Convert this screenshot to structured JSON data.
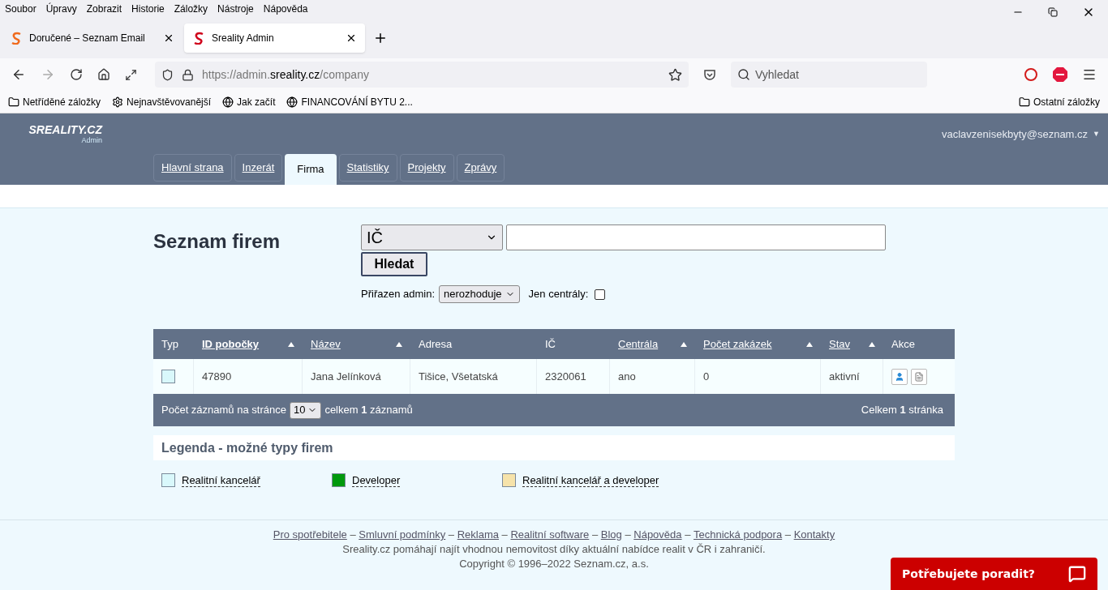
{
  "menubar": [
    "Soubor",
    "Úpravy",
    "Zobrazit",
    "Historie",
    "Záložky",
    "Nástroje",
    "Nápověda"
  ],
  "browser_tabs": [
    {
      "title": "Doručené – Seznam Email",
      "selected": false
    },
    {
      "title": "Sreality Admin",
      "selected": true
    }
  ],
  "address_bar": {
    "prefix": "https://admin.",
    "domain": "sreality.cz",
    "path": "/company"
  },
  "search_bar": {
    "placeholder": "Vyhledat"
  },
  "bookmarks": [
    "Netříděné záložky",
    "Nejnavštěvovanější",
    "Jak začít",
    "FINANCOVÁNÍ BYTU 2..."
  ],
  "other_bookmarks": "Ostatní záložky",
  "site_header": {
    "logo": "SREALITY.CZ",
    "logo_sub": "Admin",
    "user": "vaclavzenisekbyty@seznam.cz",
    "user_caret": "▼"
  },
  "nav_tabs": [
    {
      "label": "Hlavní strana",
      "selected": false
    },
    {
      "label": "Inzerát",
      "selected": false
    },
    {
      "label": "Firma",
      "selected": true
    },
    {
      "label": "Statistiky",
      "selected": false
    },
    {
      "label": "Projekty",
      "selected": false
    },
    {
      "label": "Zprávy",
      "selected": false
    }
  ],
  "search_form": {
    "title": "Seznam firem",
    "field_select": "IČ",
    "button": "Hledat",
    "admin_label": "Přiřazen admin:",
    "admin_select": "nerozhoduje",
    "central_label": "Jen centrály:",
    "central_checked": false
  },
  "table": {
    "columns": [
      {
        "label": "Typ",
        "kind": "type",
        "sortable": false,
        "bold": false
      },
      {
        "label": "ID pobočky",
        "kind": "text",
        "sortable": true,
        "bold": true
      },
      {
        "label": "Název",
        "kind": "text",
        "sortable": true,
        "bold": false
      },
      {
        "label": "Adresa",
        "kind": "text",
        "sortable": false,
        "bold": false
      },
      {
        "label": "IČ",
        "kind": "text",
        "sortable": false,
        "bold": false
      },
      {
        "label": "Centrála",
        "kind": "text",
        "sortable": true,
        "bold": false
      },
      {
        "label": "Počet zakázek",
        "kind": "text",
        "sortable": true,
        "bold": false
      },
      {
        "label": "Stav",
        "kind": "text",
        "sortable": true,
        "bold": false
      },
      {
        "label": "Akce",
        "kind": "actions",
        "sortable": false,
        "bold": false
      }
    ],
    "rows": [
      {
        "color": "#d9f8fb",
        "cells": [
          "",
          "47890",
          "Jana Jelínková",
          "Tišice, Všetatská",
          "2320061",
          "ano",
          "0",
          "aktivní",
          ""
        ]
      }
    ],
    "footer": {
      "per_page_label": "Počet záznamů na stránce",
      "per_page": "10",
      "total": "celkem **1** záznamů",
      "pages": "Celkem **1** stránka"
    }
  },
  "legend": {
    "title": "Legenda - možné typy firem",
    "items": [
      {
        "label": "Realitní kancelář",
        "color": "#d9f8fb"
      },
      {
        "label": "Developer",
        "color": "#00990d"
      },
      {
        "label": "Realitní kancelář a developer",
        "color": "#f6e3aa"
      }
    ]
  },
  "footer": {
    "links": [
      "Pro spotřebitele",
      "Smluvní podmínky",
      "Reklama",
      "Realitní software",
      "Blog",
      "Nápověda",
      "Technická podpora",
      "Kontakty"
    ],
    "separator": "–",
    "text": "Sreality.cz pomáhají najít vhodnou nemovitost díky aktuální nabídce realit v ČR i zahraničí.",
    "copyright": "Copyright © 1996–2022 Seznam.cz, a.s."
  },
  "chat_button": "Potřebujete poradit?"
}
